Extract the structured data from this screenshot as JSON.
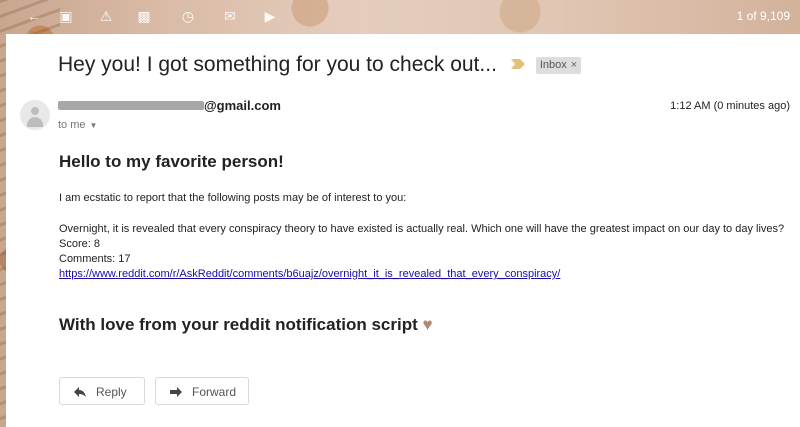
{
  "toolbar": {
    "icons": [
      "back-arrow-icon",
      "archive-icon",
      "report-spam-icon",
      "delete-icon",
      "snooze-icon",
      "mark-unread-icon",
      "move-to-icon"
    ],
    "counter": "1 of 9,109"
  },
  "message": {
    "subject": "Hey you! I got something for you to check out...",
    "label": "Inbox",
    "label_remove": "×",
    "sender_domain": "@gmail.com",
    "to": "to me",
    "time": "1:12 AM (0 minutes ago)",
    "greeting": "Hello to my favorite person!",
    "intro": "I am ecstatic to report that the following posts may be of interest to you:",
    "post_title": "Overnight, it is revealed that every conspiracy theory to have existed is actually real. Which one will have the greatest impact on our day to day lives?",
    "score": "Score: 8",
    "comments": "Comments: 17",
    "link": "https://www.reddit.com/r/AskReddit/comments/b6uajz/overnight_it_is_revealed_that_every_conspiracy/",
    "signoff": "With love from your reddit notification script",
    "heart": "♥"
  },
  "actions": {
    "reply": "Reply",
    "forward": "Forward"
  },
  "colors": {
    "link": "#1a0dab",
    "label_chip": "#dddddd",
    "heart": "#b08a70"
  }
}
